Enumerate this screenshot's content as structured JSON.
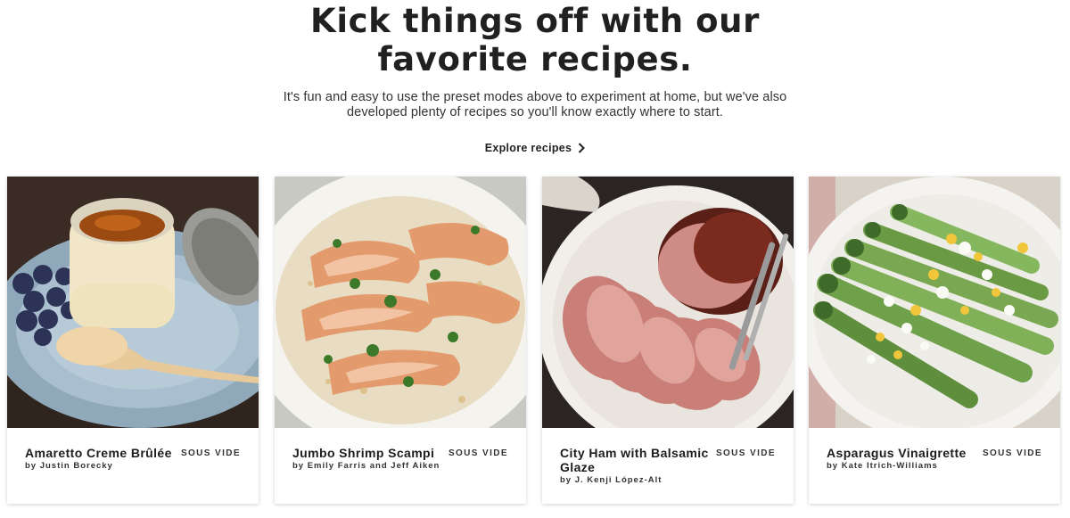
{
  "hero": {
    "title": "Kick things off with our favorite recipes.",
    "subtitle": "It's fun and easy to use the preset modes above to experiment at home, but we've also developed plenty of recipes so you'll know exactly where to start.",
    "cta_label": "Explore recipes",
    "cta_icon": "chevron-right-icon"
  },
  "recipes": [
    {
      "name": "Amaretto Creme Brûlée",
      "author": "by Justin Borecky",
      "tag": "SOUS VIDE",
      "photo": "creme-brulee-photo"
    },
    {
      "name": "Jumbo Shrimp Scampi",
      "author": "by Emily Farris and Jeff Aiken",
      "tag": "SOUS VIDE",
      "photo": "shrimp-scampi-photo"
    },
    {
      "name": "City Ham with Balsamic Glaze",
      "author": "by J. Kenji López-Alt",
      "tag": "SOUS VIDE",
      "photo": "city-ham-photo"
    },
    {
      "name": "Asparagus Vinaigrette",
      "author": "by Kate Itrich-Williams",
      "tag": "SOUS VIDE",
      "photo": "asparagus-photo"
    }
  ]
}
